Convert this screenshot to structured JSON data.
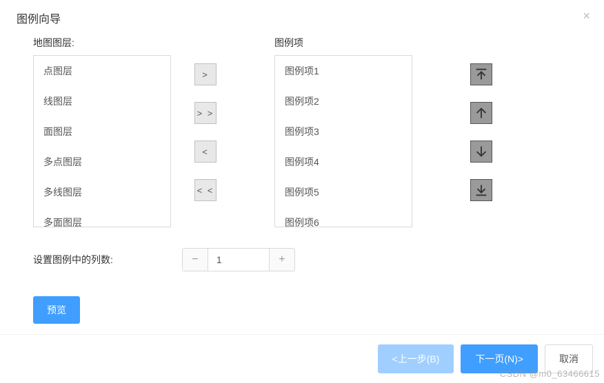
{
  "modal": {
    "title": "图例向导",
    "close_label": "×"
  },
  "left": {
    "label": "地图图层:",
    "items": [
      "点图层",
      "线图层",
      "面图层",
      "多点图层",
      "多线图层",
      "多面图层"
    ]
  },
  "transfer": {
    "add": ">",
    "add_all": "> >",
    "remove": "<",
    "remove_all": "< <"
  },
  "right": {
    "label": "图例项",
    "items": [
      "图例项1",
      "图例项2",
      "图例项3",
      "图例项4",
      "图例项5",
      "图例项6"
    ]
  },
  "arrow_icons": {
    "top": "move-top-icon",
    "up": "move-up-icon",
    "down": "move-down-icon",
    "bottom": "move-bottom-icon"
  },
  "columns_setting": {
    "label": "设置图例中的列数:",
    "value": "1",
    "minus": "−",
    "plus": "+"
  },
  "preview_label": "预览",
  "footer": {
    "prev": "<上一步(B)",
    "next": "下一页(N)>",
    "cancel": "取消"
  },
  "watermark": "CSDN @m0_63466615"
}
